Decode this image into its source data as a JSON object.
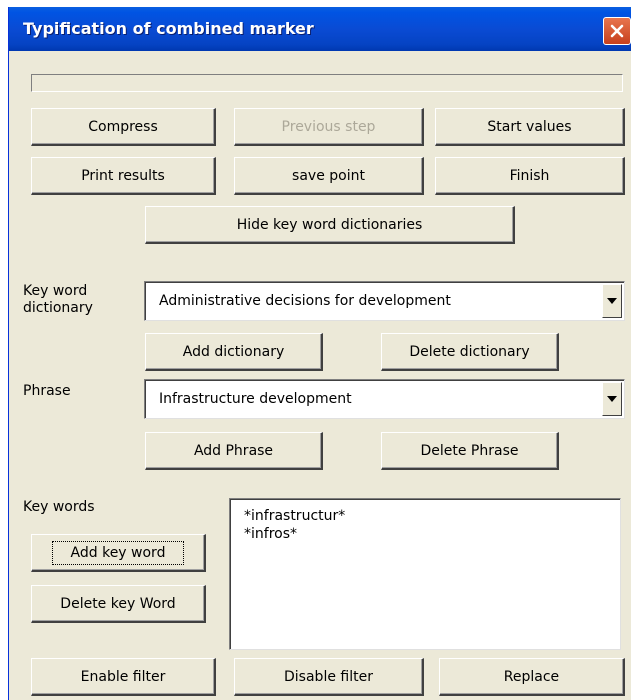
{
  "window": {
    "title": "Typification of combined marker"
  },
  "progress": {
    "value": 0
  },
  "buttons": {
    "compress": "Compress",
    "previous_step": "Previous step",
    "start_values": "Start values",
    "print_results": "Print results",
    "save_point": "save point",
    "finish": "Finish",
    "hide_dictionaries": "Hide key word dictionaries",
    "add_dictionary": "Add dictionary",
    "delete_dictionary": "Delete dictionary",
    "add_phrase": "Add Phrase",
    "delete_phrase": "Delete Phrase",
    "add_key_word": "Add key word",
    "delete_key_word": "Delete key Word",
    "enable_filter": "Enable filter",
    "disable_filter": "Disable filter",
    "replace": "Replace"
  },
  "labels": {
    "key_word_dictionary_line1": "Key word",
    "key_word_dictionary_line2": "dictionary",
    "phrase": "Phrase",
    "key_words": "Key words"
  },
  "dictionary_select": {
    "value": "Administrative decisions for development"
  },
  "phrase_select": {
    "value": "Infrastructure development"
  },
  "key_words_list": [
    "*infrastructur*",
    "*infros*"
  ],
  "icons": {
    "close": "close-x-icon",
    "dropdown": "chevron-down-icon"
  },
  "colors": {
    "titlebar": "#0054e3",
    "dialog_bg": "#ece9d8",
    "close": "#d9532e",
    "disabled_text": "#aca899"
  }
}
